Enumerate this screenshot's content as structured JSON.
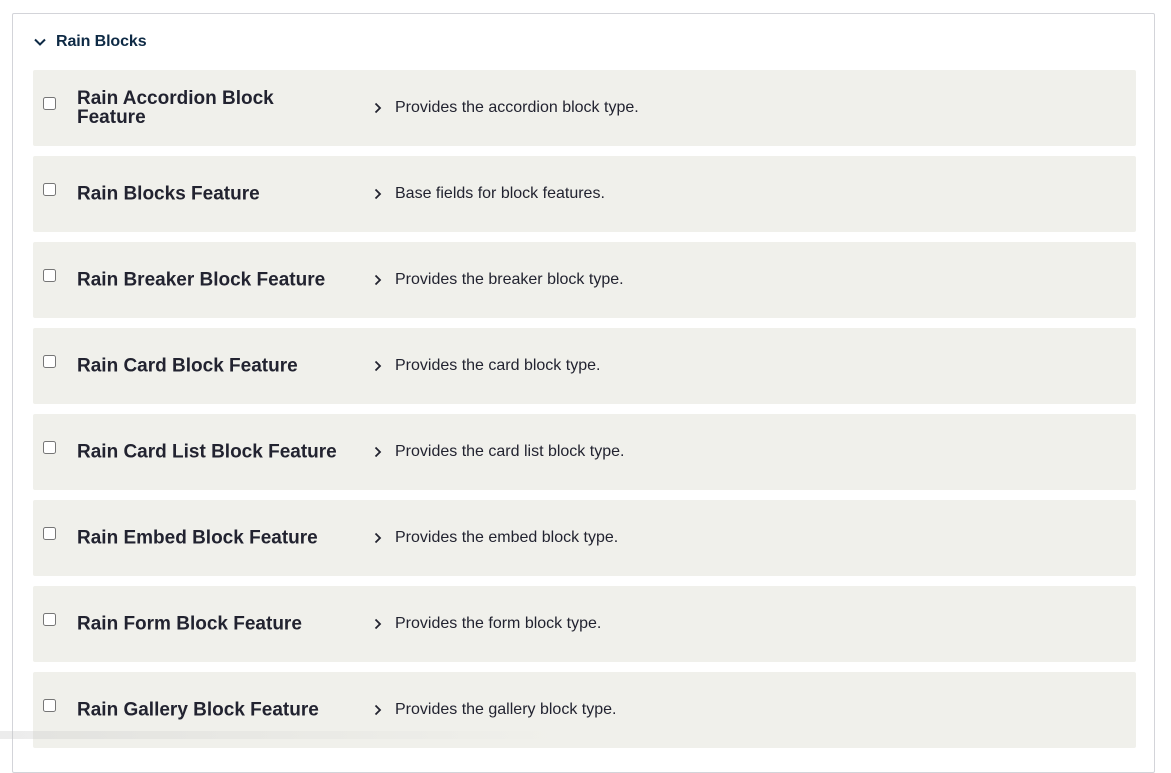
{
  "group": {
    "title": "Rain Blocks",
    "expanded_icon": "chevron-down-icon"
  },
  "modules": [
    {
      "name": "Rain Accordion Block Feature",
      "description": "Provides the accordion block type.",
      "checked": false
    },
    {
      "name": "Rain Blocks Feature",
      "description": "Base fields for block features.",
      "checked": false
    },
    {
      "name": "Rain Breaker Block Feature",
      "description": "Provides the breaker block type.",
      "checked": false
    },
    {
      "name": "Rain Card Block Feature",
      "description": "Provides the card block type.",
      "checked": false
    },
    {
      "name": "Rain Card List Block Feature",
      "description": "Provides the card list block type.",
      "checked": false
    },
    {
      "name": "Rain Embed Block Feature",
      "description": "Provides the embed block type.",
      "checked": false
    },
    {
      "name": "Rain Form Block Feature",
      "description": "Provides the form block type.",
      "checked": false
    },
    {
      "name": "Rain Gallery Block Feature",
      "description": "Provides the gallery block type.",
      "checked": false
    }
  ],
  "colors": {
    "row_background": "#f0f0eb",
    "group_title": "#0e2a45",
    "text": "#222330",
    "border": "#d3d4d9"
  }
}
